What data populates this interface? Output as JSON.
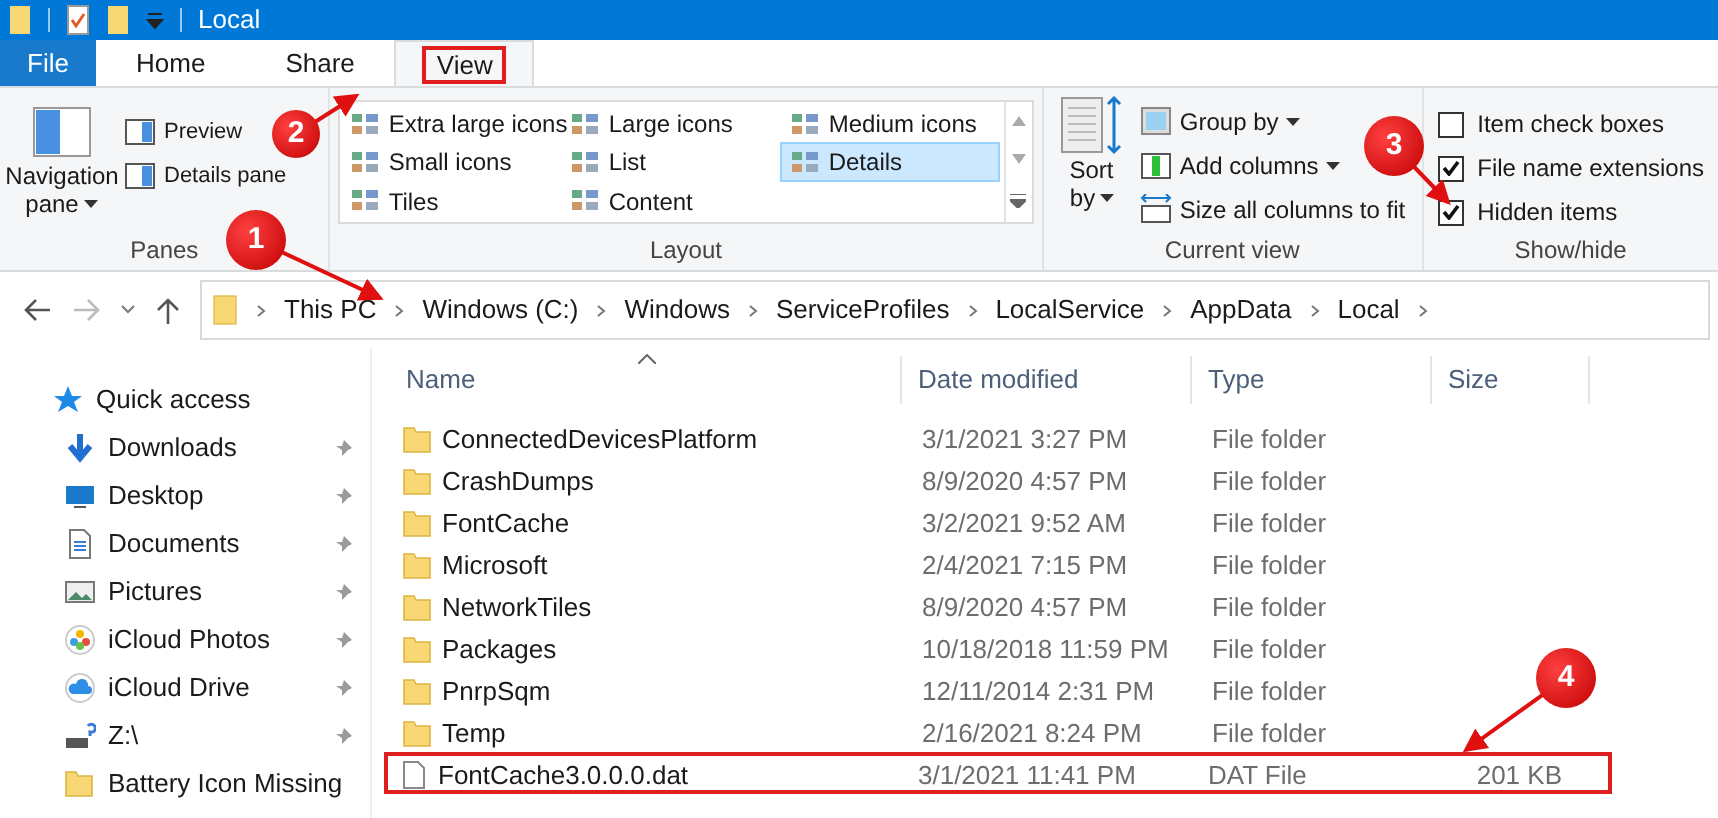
{
  "window": {
    "title": "Local"
  },
  "ribbon_tabs": [
    {
      "label": "File",
      "kind": "file",
      "selected": false,
      "highlighted": false
    },
    {
      "label": "Home",
      "kind": "tab",
      "selected": false,
      "highlighted": false
    },
    {
      "label": "Share",
      "kind": "tab",
      "selected": false,
      "highlighted": false
    },
    {
      "label": "View",
      "kind": "tab",
      "selected": true,
      "highlighted": true
    }
  ],
  "ribbon": {
    "panes": {
      "label": "Panes",
      "large_button": [
        "Navigation",
        "pane"
      ],
      "buttons": [
        "Preview",
        "Details pane"
      ]
    },
    "layout": {
      "label": "Layout",
      "options": [
        {
          "label": "Extra large icons",
          "selected": false
        },
        {
          "label": "Small icons",
          "selected": false
        },
        {
          "label": "Tiles",
          "selected": false
        },
        {
          "label": "Large icons",
          "selected": false
        },
        {
          "label": "List",
          "selected": false
        },
        {
          "label": "Content",
          "selected": false
        },
        {
          "label": "Medium icons",
          "selected": false
        },
        {
          "label": "Details",
          "selected": true
        }
      ]
    },
    "current_view": {
      "label": "Current view",
      "sort_by": [
        "Sort",
        "by"
      ],
      "buttons": [
        {
          "label": "Group by",
          "dropdown": true
        },
        {
          "label": "Add columns",
          "dropdown": true
        },
        {
          "label": "Size all columns to fit",
          "dropdown": false
        }
      ]
    },
    "show_hide": {
      "label": "Show/hide",
      "checkboxes": [
        {
          "label": "Item check boxes",
          "checked": false
        },
        {
          "label": "File name extensions",
          "checked": true
        },
        {
          "label": "Hidden items",
          "checked": true
        }
      ]
    }
  },
  "address_bar": {
    "path": [
      "This PC",
      "Windows (C:)",
      "Windows",
      "ServiceProfiles",
      "LocalService",
      "AppData",
      "Local"
    ]
  },
  "sidebar": {
    "items": [
      {
        "label": "Quick access",
        "kind": "star",
        "pinned": false
      },
      {
        "label": "Downloads",
        "kind": "downloads",
        "pinned": true
      },
      {
        "label": "Desktop",
        "kind": "desktop",
        "pinned": true
      },
      {
        "label": "Documents",
        "kind": "documents",
        "pinned": true
      },
      {
        "label": "Pictures",
        "kind": "pictures",
        "pinned": true
      },
      {
        "label": "iCloud Photos",
        "kind": "photos",
        "pinned": true
      },
      {
        "label": "iCloud Drive",
        "kind": "cloud",
        "pinned": true
      },
      {
        "label": "Z:\\",
        "kind": "drive",
        "pinned": true
      },
      {
        "label": "Battery Icon Missing",
        "kind": "folder",
        "pinned": false
      }
    ]
  },
  "file_list": {
    "columns": [
      "Name",
      "Date modified",
      "Type",
      "Size"
    ],
    "rows": [
      {
        "name": "ConnectedDevicesPlatform",
        "date": "3/1/2021 3:27 PM",
        "type": "File folder",
        "kind": "folder",
        "highlighted": false
      },
      {
        "name": "CrashDumps",
        "date": "8/9/2020 4:57 PM",
        "type": "File folder",
        "kind": "folder",
        "highlighted": false
      },
      {
        "name": "FontCache",
        "date": "3/2/2021 9:52 AM",
        "type": "File folder",
        "kind": "folder",
        "highlighted": false
      },
      {
        "name": "Microsoft",
        "date": "2/4/2021 7:15 PM",
        "type": "File folder",
        "kind": "folder",
        "highlighted": false
      },
      {
        "name": "NetworkTiles",
        "date": "8/9/2020 4:57 PM",
        "type": "File folder",
        "kind": "folder",
        "highlighted": false
      },
      {
        "name": "Packages",
        "date": "10/18/2018 11:59 PM",
        "type": "File folder",
        "kind": "folder",
        "highlighted": false
      },
      {
        "name": "PnrpSqm",
        "date": "12/11/2014 2:31 PM",
        "type": "File folder",
        "kind": "folder",
        "highlighted": false
      },
      {
        "name": "Temp",
        "date": "2/16/2021 8:24 PM",
        "type": "File folder",
        "kind": "folder",
        "highlighted": false
      },
      {
        "name": "FontCache3.0.0.0.dat",
        "date": "3/1/2021 11:41 PM",
        "type": "DAT File",
        "size": "201 KB",
        "kind": "file",
        "highlighted": true
      }
    ]
  },
  "annotations": [
    "1",
    "2",
    "3",
    "4"
  ]
}
